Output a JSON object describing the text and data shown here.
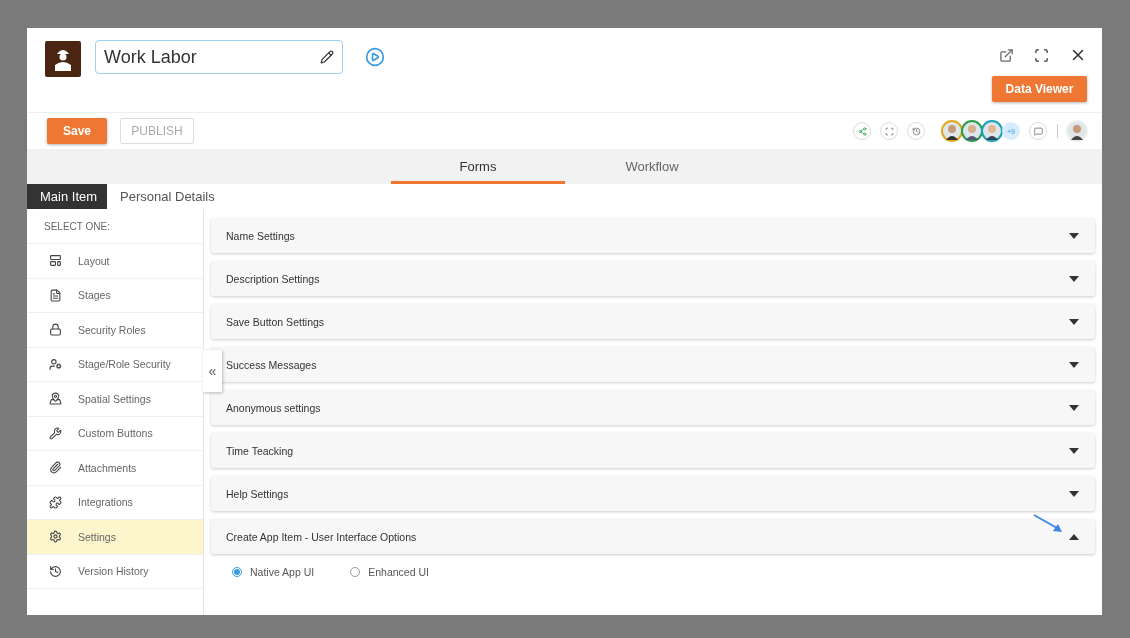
{
  "header": {
    "title_value": "Work Labor",
    "data_viewer": "Data Viewer"
  },
  "toolbar": {
    "save": "Save",
    "publish": "PUBLISH",
    "more_collaborators": "+9"
  },
  "tabs": [
    {
      "label": "Forms",
      "selected": true
    },
    {
      "label": "Workflow",
      "selected": false
    }
  ],
  "sub_tabs": [
    {
      "label": "Main Item",
      "selected": true
    },
    {
      "label": "Personal Details",
      "selected": false
    }
  ],
  "sidebar": {
    "heading": "SELECT ONE:",
    "items": [
      {
        "label": "Layout",
        "selected": false
      },
      {
        "label": "Stages",
        "selected": false
      },
      {
        "label": "Security Roles",
        "selected": false
      },
      {
        "label": "Stage/Role Security",
        "selected": false
      },
      {
        "label": "Spatial Settings",
        "selected": false
      },
      {
        "label": "Custom Buttons",
        "selected": false
      },
      {
        "label": "Attachments",
        "selected": false
      },
      {
        "label": "Integrations",
        "selected": false
      },
      {
        "label": "Settings",
        "selected": true
      },
      {
        "label": "Version History",
        "selected": false
      }
    ]
  },
  "collapse_button": "«",
  "sections": [
    {
      "title": "Name Settings",
      "expanded": false
    },
    {
      "title": "Description Settings",
      "expanded": false
    },
    {
      "title": "Save Button Settings",
      "expanded": false
    },
    {
      "title": "Success Messages",
      "expanded": false
    },
    {
      "title": "Anonymous settings",
      "expanded": false
    },
    {
      "title": "Time Teacking",
      "expanded": false
    },
    {
      "title": "Help Settings",
      "expanded": false
    },
    {
      "title": "Create App Item - User Interface Options",
      "expanded": true,
      "options": [
        {
          "label": "Native App UI",
          "selected": true
        },
        {
          "label": "Enhanced UI",
          "selected": false
        }
      ]
    }
  ]
}
